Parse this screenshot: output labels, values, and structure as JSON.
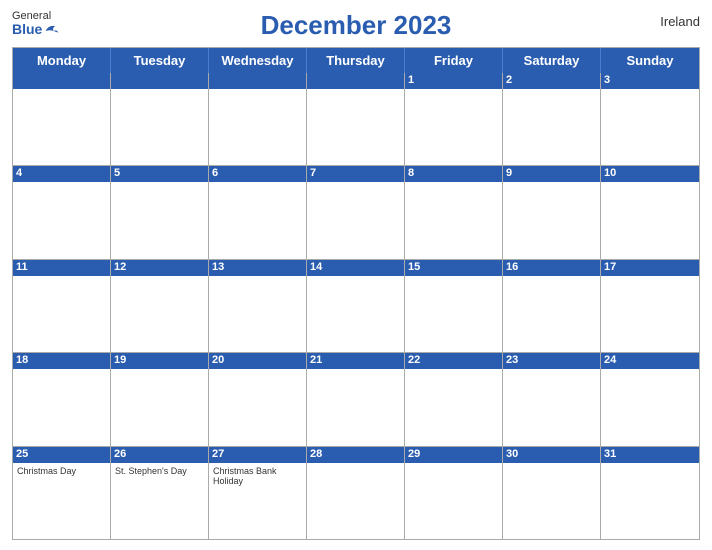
{
  "header": {
    "title": "December 2023",
    "country": "Ireland",
    "logo_general": "General",
    "logo_blue": "Blue"
  },
  "days": {
    "headers": [
      "Monday",
      "Tuesday",
      "Wednesday",
      "Thursday",
      "Friday",
      "Saturday",
      "Sunday"
    ]
  },
  "weeks": [
    [
      {
        "num": "",
        "empty": true,
        "events": []
      },
      {
        "num": "",
        "empty": true,
        "events": []
      },
      {
        "num": "",
        "empty": true,
        "events": []
      },
      {
        "num": "",
        "empty": true,
        "events": []
      },
      {
        "num": "1",
        "empty": false,
        "events": []
      },
      {
        "num": "2",
        "empty": false,
        "events": []
      },
      {
        "num": "3",
        "empty": false,
        "events": []
      }
    ],
    [
      {
        "num": "4",
        "empty": false,
        "events": []
      },
      {
        "num": "5",
        "empty": false,
        "events": []
      },
      {
        "num": "6",
        "empty": false,
        "events": []
      },
      {
        "num": "7",
        "empty": false,
        "events": []
      },
      {
        "num": "8",
        "empty": false,
        "events": []
      },
      {
        "num": "9",
        "empty": false,
        "events": []
      },
      {
        "num": "10",
        "empty": false,
        "events": []
      }
    ],
    [
      {
        "num": "11",
        "empty": false,
        "events": []
      },
      {
        "num": "12",
        "empty": false,
        "events": []
      },
      {
        "num": "13",
        "empty": false,
        "events": []
      },
      {
        "num": "14",
        "empty": false,
        "events": []
      },
      {
        "num": "15",
        "empty": false,
        "events": []
      },
      {
        "num": "16",
        "empty": false,
        "events": []
      },
      {
        "num": "17",
        "empty": false,
        "events": []
      }
    ],
    [
      {
        "num": "18",
        "empty": false,
        "events": []
      },
      {
        "num": "19",
        "empty": false,
        "events": []
      },
      {
        "num": "20",
        "empty": false,
        "events": []
      },
      {
        "num": "21",
        "empty": false,
        "events": []
      },
      {
        "num": "22",
        "empty": false,
        "events": []
      },
      {
        "num": "23",
        "empty": false,
        "events": []
      },
      {
        "num": "24",
        "empty": false,
        "events": []
      }
    ],
    [
      {
        "num": "25",
        "empty": false,
        "events": [
          "Christmas Day"
        ]
      },
      {
        "num": "26",
        "empty": false,
        "events": [
          "St. Stephen's Day"
        ]
      },
      {
        "num": "27",
        "empty": false,
        "events": [
          "Christmas Bank Holiday"
        ]
      },
      {
        "num": "28",
        "empty": false,
        "events": []
      },
      {
        "num": "29",
        "empty": false,
        "events": []
      },
      {
        "num": "30",
        "empty": false,
        "events": []
      },
      {
        "num": "31",
        "empty": false,
        "events": []
      }
    ]
  ]
}
